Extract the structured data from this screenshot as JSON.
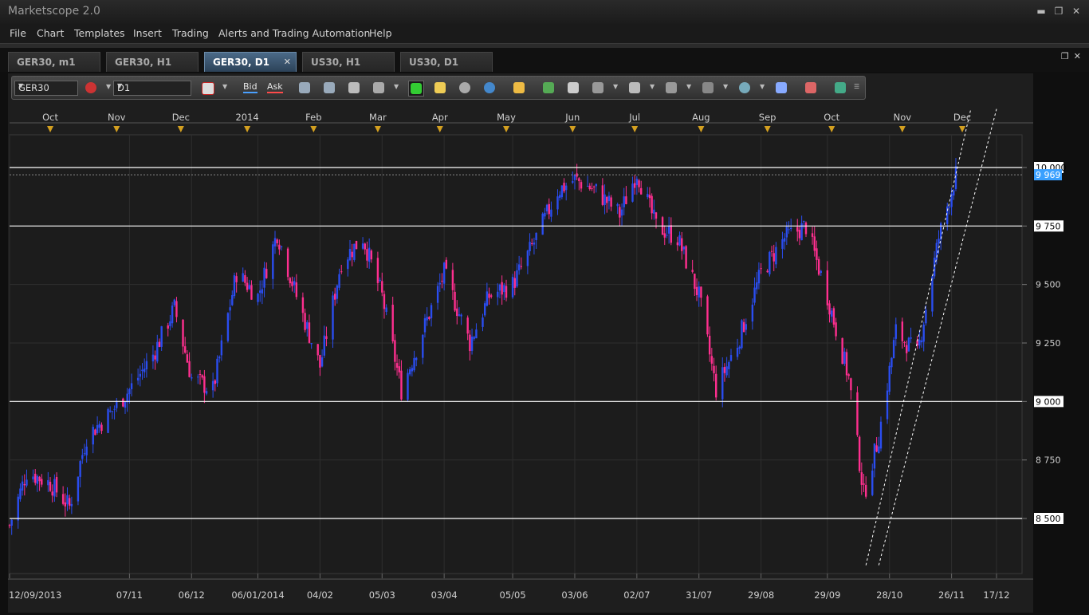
{
  "window": {
    "title": "Marketscope 2.0"
  },
  "menu": [
    "File",
    "Chart",
    "Templates",
    "Insert",
    "Trading",
    "Alerts and Trading Automation",
    "Help"
  ],
  "tabs": [
    {
      "label": "GER30, m1",
      "active": false
    },
    {
      "label": "GER30, H1",
      "active": false
    },
    {
      "label": "GER30, D1",
      "active": true
    },
    {
      "label": "US30, H1",
      "active": false
    },
    {
      "label": "US30, D1",
      "active": false
    }
  ],
  "toolbar": {
    "symbol": "GER30",
    "timeframe": "D1",
    "bid_label": "Bid",
    "ask_label": "Ask"
  },
  "colors": {
    "bull": "#2a4df0",
    "bear": "#ff2f8f",
    "level_line": "#ffffff",
    "channel": "#ffffff",
    "last_price_badge": "#3aa0ff"
  },
  "chart_data": {
    "type": "candlestick",
    "symbol": "GER30",
    "timeframe": "D1",
    "top_month_labels": [
      "Oct",
      "Nov",
      "Dec",
      "2014",
      "Feb",
      "Mar",
      "Apr",
      "May",
      "Jun",
      "Jul",
      "Aug",
      "Sep",
      "Oct",
      "Nov",
      "Dec"
    ],
    "x_tick_labels": [
      "12/09/2013",
      "07/11",
      "06/12",
      "06/01/2014",
      "04/02",
      "05/03",
      "03/04",
      "05/05",
      "03/06",
      "02/07",
      "31/07",
      "29/08",
      "29/09",
      "28/10",
      "26/11",
      "17/12"
    ],
    "y_ticks": [
      8500,
      8750,
      9000,
      9250,
      9500,
      9750,
      10000
    ],
    "y_tick_labels": [
      "8 500",
      "8 750",
      "9 000",
      "9 250",
      "9 500",
      "9 750",
      "10 000"
    ],
    "ylim": [
      8300,
      10250
    ],
    "horizontal_levels": [
      8500,
      9000,
      9750,
      10000
    ],
    "last_price": 9969,
    "last_price_label": "9 969",
    "trend_channel": [
      {
        "from": [
          "17/10/2014",
          8300
        ],
        "to": [
          "05/12/2014",
          10250
        ]
      },
      {
        "from": [
          "23/10/2014",
          8300
        ],
        "to": [
          "17/12/2014",
          10250
        ]
      }
    ],
    "grid": true,
    "price_path": [
      [
        "12/09/2013",
        8470
      ],
      [
        "20/09/2013",
        8700
      ],
      [
        "01/10/2013",
        8650
      ],
      [
        "10/10/2013",
        8550
      ],
      [
        "18/10/2013",
        8850
      ],
      [
        "29/10/2013",
        8950
      ],
      [
        "07/11/2013",
        9050
      ],
      [
        "18/11/2013",
        9200
      ],
      [
        "28/11/2013",
        9400
      ],
      [
        "06/12/2013",
        9100
      ],
      [
        "16/12/2013",
        9050
      ],
      [
        "27/12/2013",
        9550
      ],
      [
        "06/01/2014",
        9450
      ],
      [
        "15/01/2014",
        9720
      ],
      [
        "24/01/2014",
        9450
      ],
      [
        "04/02/2014",
        9150
      ],
      [
        "14/02/2014",
        9600
      ],
      [
        "24/02/2014",
        9700
      ],
      [
        "05/03/2014",
        9450
      ],
      [
        "14/03/2014",
        9050
      ],
      [
        "24/03/2014",
        9300
      ],
      [
        "03/04/2014",
        9550
      ],
      [
        "15/04/2014",
        9250
      ],
      [
        "24/04/2014",
        9450
      ],
      [
        "05/05/2014",
        9500
      ],
      [
        "15/05/2014",
        9680
      ],
      [
        "26/05/2014",
        9900
      ],
      [
        "03/06/2014",
        9950
      ],
      [
        "13/06/2014",
        9900
      ],
      [
        "24/06/2014",
        9800
      ],
      [
        "02/07/2014",
        9980
      ],
      [
        "11/07/2014",
        9750
      ],
      [
        "21/07/2014",
        9700
      ],
      [
        "31/07/2014",
        9450
      ],
      [
        "08/08/2014",
        9050
      ],
      [
        "18/08/2014",
        9250
      ],
      [
        "29/08/2014",
        9550
      ],
      [
        "09/09/2014",
        9700
      ],
      [
        "19/09/2014",
        9750
      ],
      [
        "29/09/2014",
        9450
      ],
      [
        "09/10/2014",
        9100
      ],
      [
        "16/10/2014",
        8600
      ],
      [
        "23/10/2014",
        8850
      ],
      [
        "31/10/2014",
        9300
      ],
      [
        "10/11/2014",
        9200
      ],
      [
        "20/11/2014",
        9700
      ],
      [
        "28/11/2014",
        9969
      ]
    ]
  }
}
